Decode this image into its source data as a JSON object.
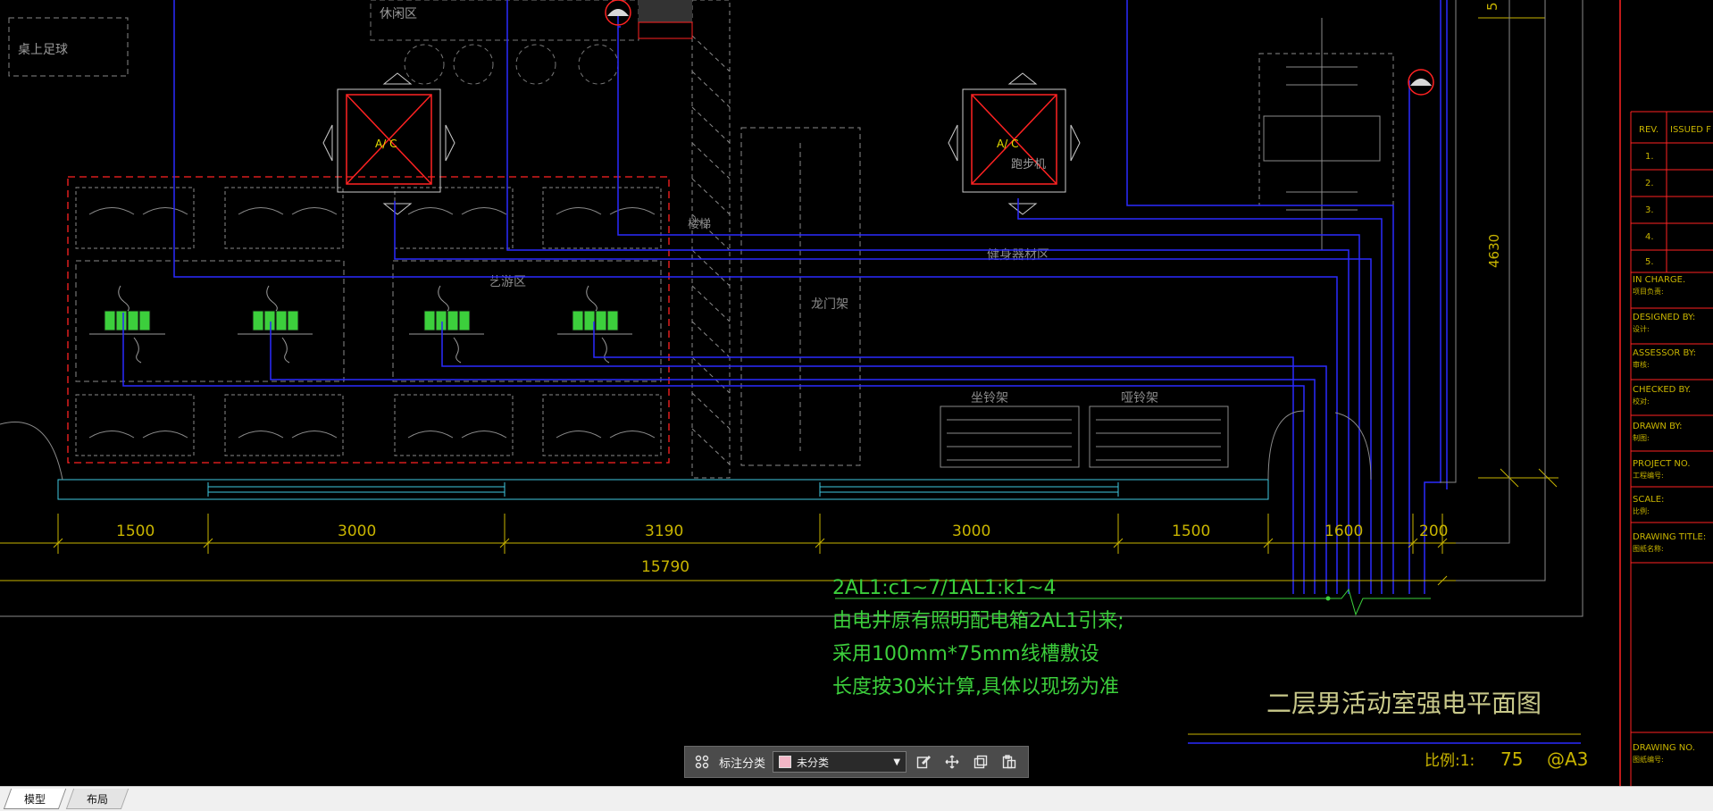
{
  "drawing": {
    "zones": {
      "rest": "休闲区",
      "tabletop": "桌上足球",
      "art": "艺游区",
      "fitness": "健身器材区",
      "stairs": "楼梯",
      "treadmill": "跑步机",
      "door_frame": "龙门架",
      "seat_rack": "坐铃架",
      "dumbbell_rack": "哑铃架",
      "ac": "A/ C"
    },
    "dimensions": [
      "1500",
      "3000",
      "3190",
      "3000",
      "1500",
      "1600",
      "200"
    ],
    "total_dimension": "15790",
    "vertical_dimension": "4630",
    "top_dimension": "5",
    "notes": [
      "2AL1:c1~7/1AL1:k1~4",
      "由电井原有照明配电箱2AL1引来;",
      "采用100mm*75mm线槽敷设",
      "长度按30米计算,具体以现场为准"
    ],
    "title": "二层男活动室强电平面图",
    "scale_label": "比例:1:",
    "scale_value": "75",
    "paper": "@A3"
  },
  "title_block": {
    "rev_header": "REV.",
    "issued_header": "ISSUED F",
    "revs": [
      "1.",
      "2.",
      "3.",
      "4.",
      "5."
    ],
    "fields": [
      {
        "en": "IN CHARGE.",
        "cn": "项目负责:"
      },
      {
        "en": "DESIGNED BY:",
        "cn": "设计:"
      },
      {
        "en": "ASSESSOR BY:",
        "cn": "审核:"
      },
      {
        "en": "CHECKED BY.",
        "cn": "校对:"
      },
      {
        "en": "DRAWN BY:",
        "cn": "制图:"
      },
      {
        "en": "PROJECT NO.",
        "cn": "工程编号:"
      },
      {
        "en": "SCALE:",
        "cn": "比例:"
      },
      {
        "en": "DRAWING TITLE:",
        "cn": "图纸名称:"
      },
      {
        "en": "DRAWING NO.",
        "cn": "图纸编号:"
      }
    ]
  },
  "toolbar": {
    "label": "标注分类",
    "category": "未分类",
    "icons": [
      "grid-icon",
      "edit-icon",
      "move-icon",
      "copy-icon",
      "paste-icon"
    ]
  },
  "tabs": {
    "model": "模型",
    "layout": "布局"
  },
  "colors": {
    "background": "#000000",
    "wire_blue": "#2a2aff",
    "dim_yellow": "#c8b400",
    "note_green": "#3ccf3c",
    "red": "#ff2222",
    "grey_lines": "#9a9a9a",
    "cyan": "#3fc8e0"
  }
}
